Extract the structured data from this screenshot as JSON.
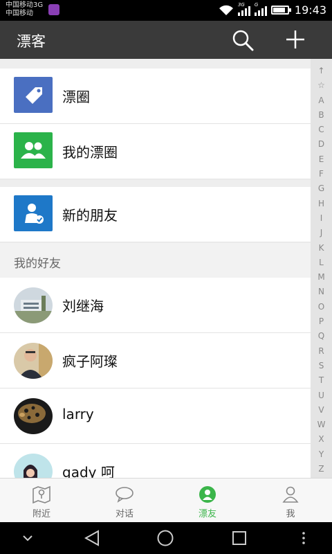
{
  "status": {
    "carrier_line1": "中国移动3G",
    "carrier_line2": "中国移动",
    "net1": "3G",
    "net2": "G",
    "battery_level": 0.85,
    "time": "19:43"
  },
  "appbar": {
    "title": "漂客",
    "icons": [
      "search-icon",
      "plus-icon"
    ]
  },
  "top_items": [
    {
      "label": "漂圈",
      "icon": "tag-icon",
      "color": "#4a6fc1"
    },
    {
      "label": "我的漂圈",
      "icon": "people-icon",
      "color": "#2bb34a"
    },
    {
      "label": "新的朋友",
      "icon": "add-friend-icon",
      "color": "#1e78c8"
    }
  ],
  "friends_section": "我的好友",
  "friends": [
    {
      "name": "刘继海"
    },
    {
      "name": "疯子阿璨"
    },
    {
      "name": "larry"
    },
    {
      "name": "gady 呵"
    }
  ],
  "index_letters": [
    "↑",
    "☆",
    "A",
    "B",
    "C",
    "D",
    "E",
    "F",
    "G",
    "H",
    "I",
    "J",
    "K",
    "L",
    "M",
    "N",
    "O",
    "P",
    "Q",
    "R",
    "S",
    "T",
    "U",
    "V",
    "W",
    "X",
    "Y",
    "Z"
  ],
  "tabs": [
    {
      "label": "附近",
      "icon": "map-icon",
      "active": false
    },
    {
      "label": "对话",
      "icon": "chat-icon",
      "active": false
    },
    {
      "label": "漂友",
      "icon": "contacts-icon",
      "active": true
    },
    {
      "label": "我",
      "icon": "person-icon",
      "active": false
    }
  ],
  "colors": {
    "accent": "#3bb54a",
    "appbar": "#3a3a3a"
  }
}
